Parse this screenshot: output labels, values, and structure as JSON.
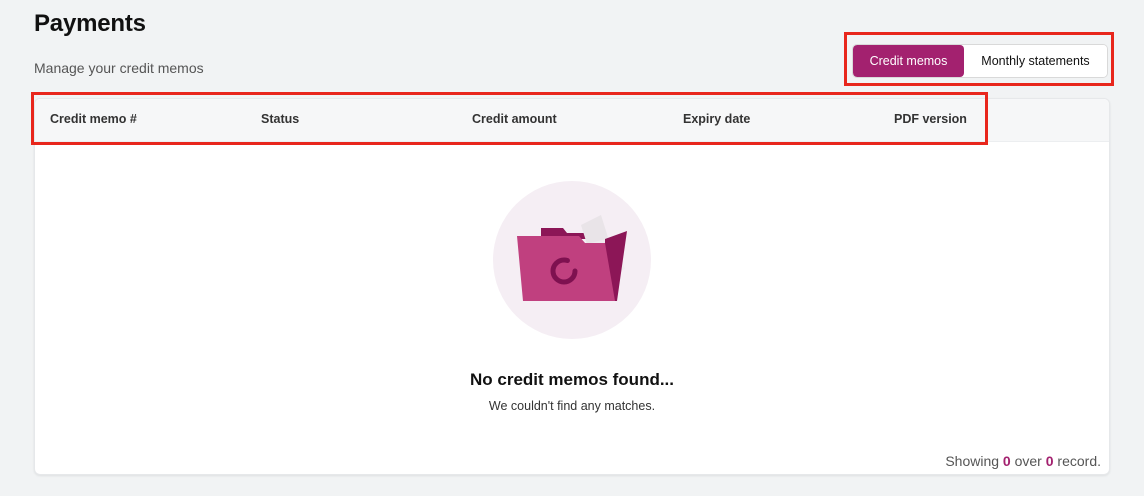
{
  "header": {
    "title": "Payments",
    "subtitle": "Manage your credit memos"
  },
  "toggle": {
    "active_label": "Credit memos",
    "inactive_label": "Monthly statements"
  },
  "table": {
    "columns": [
      "Credit memo #",
      "Status",
      "Credit amount",
      "Expiry date",
      "PDF version"
    ]
  },
  "empty_state": {
    "title": "No credit memos found...",
    "description": "We couldn't find any matches.",
    "icon": "folder-icon"
  },
  "footer": {
    "showing_label": "Showing",
    "shown_count": "0",
    "over_label": "over",
    "total_count": "0",
    "record_label": "record."
  },
  "colors": {
    "accent": "#a3216f",
    "highlight": "#e8261c",
    "illustration_bg": "#f5eef4"
  }
}
